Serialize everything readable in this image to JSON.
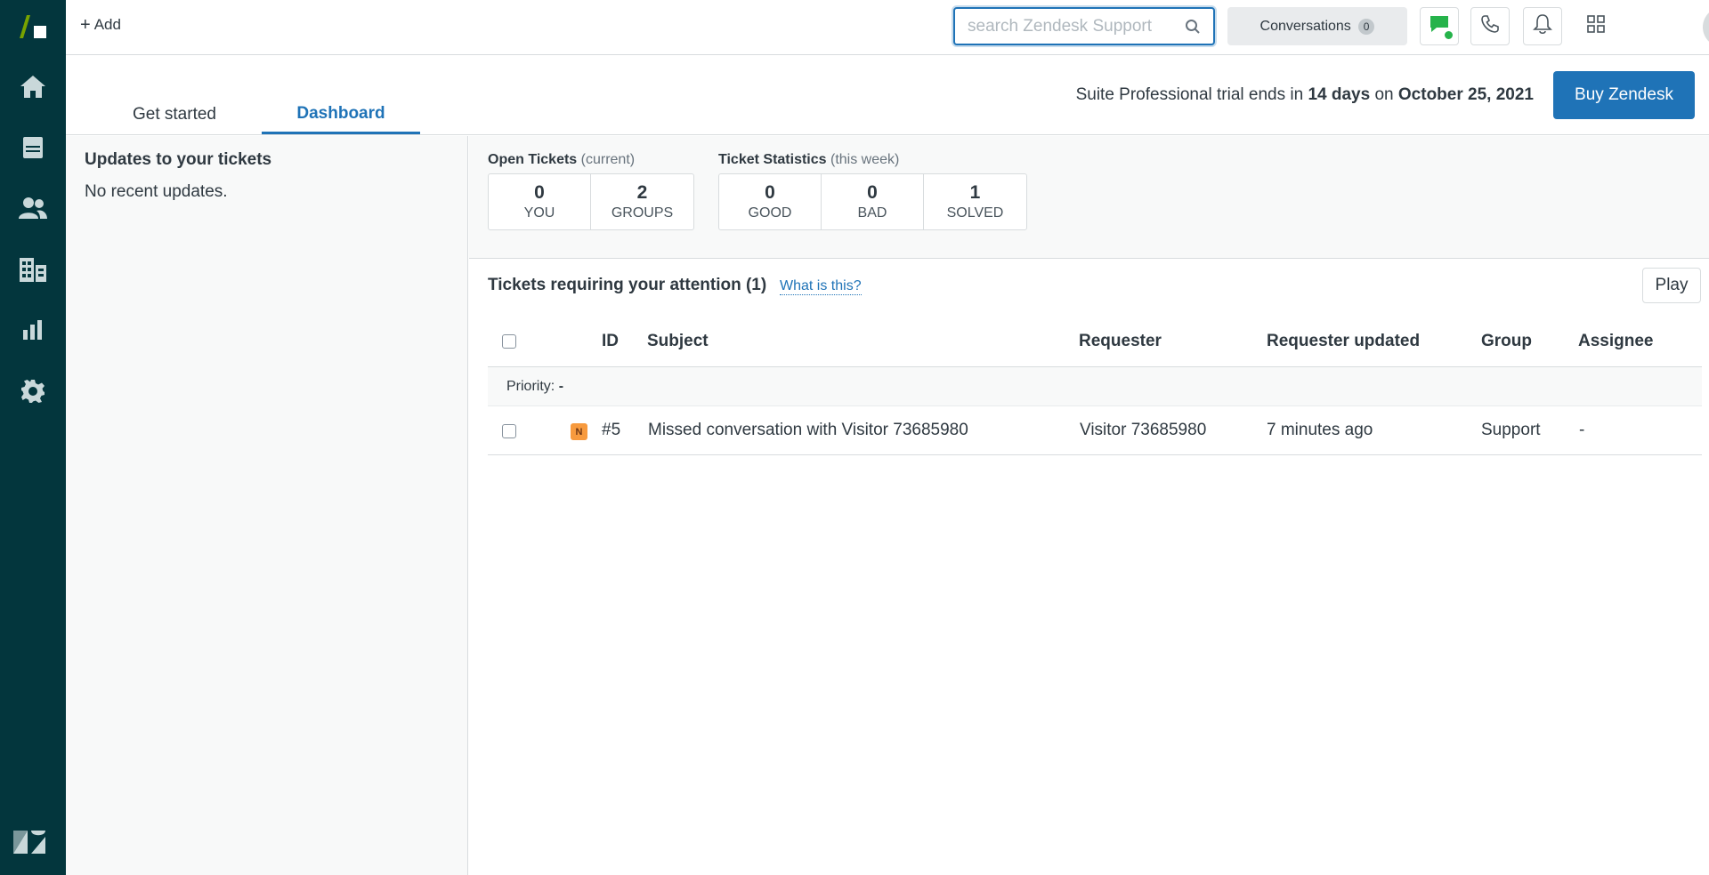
{
  "topbar": {
    "add_label": "Add",
    "search_placeholder": "search Zendesk Support",
    "conversations_label": "Conversations",
    "conversations_count": "0"
  },
  "tabs": [
    {
      "label": "Get started"
    },
    {
      "label": "Dashboard"
    }
  ],
  "trial": {
    "prefix": "Suite Professional trial ends in",
    "days": "14 days",
    "middle": "on",
    "date": "October 25, 2021"
  },
  "buy_label": "Buy Zendesk",
  "updates": {
    "title": "Updates to your tickets",
    "empty": "No recent updates."
  },
  "open_tickets": {
    "title": "Open Tickets",
    "sub": "(current)",
    "cells": [
      {
        "num": "0",
        "label": "YOU"
      },
      {
        "num": "2",
        "label": "GROUPS"
      }
    ]
  },
  "ticket_stats": {
    "title": "Ticket Statistics",
    "sub": "(this week)",
    "cells": [
      {
        "num": "0",
        "label": "GOOD"
      },
      {
        "num": "0",
        "label": "BAD"
      },
      {
        "num": "1",
        "label": "SOLVED"
      }
    ]
  },
  "attention": {
    "title": "Tickets requiring your attention (1)",
    "what_is_this": "What is this?",
    "play": "Play"
  },
  "table": {
    "headers": {
      "id": "ID",
      "subject": "Subject",
      "requester": "Requester",
      "requester_updated": "Requester updated",
      "group": "Group",
      "assignee": "Assignee"
    },
    "group_label": "Priority:",
    "group_value": "-",
    "rows": [
      {
        "status": "N",
        "id": "#5",
        "subject": "Missed conversation with Visitor 73685980",
        "requester": "Visitor 73685980",
        "requester_updated": "7 minutes ago",
        "group": "Support",
        "assignee": "-"
      }
    ]
  },
  "colors": {
    "nav_bg": "#03363d",
    "accent": "#1f73b7",
    "online": "#26b34b",
    "status_new": "#f79a3e",
    "logo_green": "#78a300"
  }
}
